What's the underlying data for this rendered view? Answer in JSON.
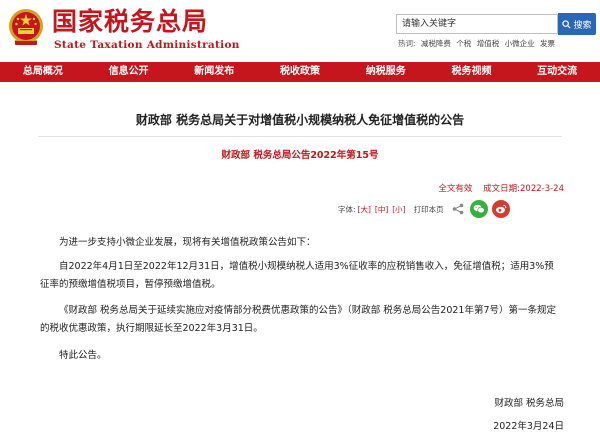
{
  "header": {
    "site_title": "国家税务总局",
    "site_subtitle": "State Taxation Administration",
    "search": {
      "placeholder": "请输入关键字",
      "button_label": "搜索"
    },
    "hot_words": {
      "label": "热词:",
      "items": [
        "减税降费",
        "个税",
        "增值税",
        "小微企业",
        "发票"
      ]
    }
  },
  "nav": {
    "items": [
      "总局概况",
      "信息公开",
      "新闻发布",
      "税收政策",
      "纳税服务",
      "税务视频",
      "互动交流"
    ]
  },
  "article": {
    "title": "财政部 税务总局关于对增值税小规模纳税人免征增值税的公告",
    "doc_number": "财政部 税务总局公告2022年第15号",
    "validity": "全文有效",
    "date_label": "成文日期:",
    "date_value": "2022-3-24",
    "tools": {
      "font_label": "字体:",
      "font_large": "[大]",
      "font_medium": "[中]",
      "font_small": "[小]",
      "print_label": "打印本页"
    },
    "paragraphs": [
      "为进一步支持小微企业发展，现将有关增值税政策公告如下：",
      "自2022年4月1日至2022年12月31日，增值税小规模纳税人适用3%征收率的应税销售收入，免征增值税；适用3%预征率的预缴增值税项目，暂停预缴增值税。",
      "《财政部 税务总局关于延续实施应对疫情部分税费优惠政策的公告》（财政部 税务总局公告2021年第7号）第一条规定的税收优惠政策，执行期限延长至2022年3月31日。",
      "特此公告。"
    ],
    "signature_org": "财政部 税务总局",
    "signature_date": "2022年3月24日"
  },
  "icons": {
    "emblem": "national-emblem-icon",
    "search": "search-icon",
    "share": "share-icon",
    "wechat": "wechat-icon",
    "weibo": "weibo-icon"
  },
  "colors": {
    "brand_red": "#c4161c",
    "search_blue": "#2a67b6",
    "wechat_green": "#38b03f",
    "weibo_red": "#d63b2f"
  }
}
